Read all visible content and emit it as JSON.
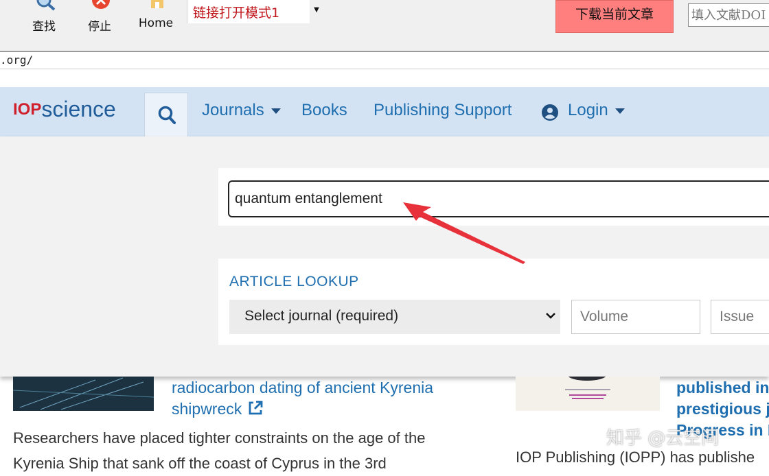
{
  "toolbar": {
    "find_label": "查找",
    "stop_label": "停止",
    "home_label": "Home",
    "mode_value": "链接打开模式1",
    "download_label": "下载当前文章",
    "doi_placeholder": "填入文献DOI"
  },
  "address": {
    "url": ".org/"
  },
  "site": {
    "logo_iop": "IOP",
    "logo_science": "science",
    "nav": {
      "journals": "Journals",
      "books": "Books",
      "publishing_support": "Publishing Support",
      "login": "Login"
    }
  },
  "search": {
    "query": "quantum entanglement"
  },
  "lookup": {
    "heading": "ARTICLE LOOKUP",
    "journal_selected": "Select journal (required)",
    "volume_placeholder": "Volume",
    "issue_placeholder": "Issue"
  },
  "articles": [
    {
      "title_line1": "radiocarbon dating of ancient Kyrenia",
      "title_line2": "shipwreck",
      "snippet_line1": "Researchers have placed tighter constraints on the age of the",
      "snippet_line2": "Kyrenia Ship that sank off the coast of Cyprus in the 3rd"
    },
    {
      "title_line1": "published in",
      "title_line2": "prestigious j",
      "title_line3": "Progress in P",
      "snippet": "IOP Publishing (IOPP) has publishe"
    }
  ],
  "watermark": "知乎 @云空间",
  "colors": {
    "nav_bg": "#d3e3f3",
    "brand_red": "#d0202e",
    "link_blue": "#1f6fb0",
    "download_bg": "#ff7f7f",
    "annotation_red": "#e8323b"
  }
}
